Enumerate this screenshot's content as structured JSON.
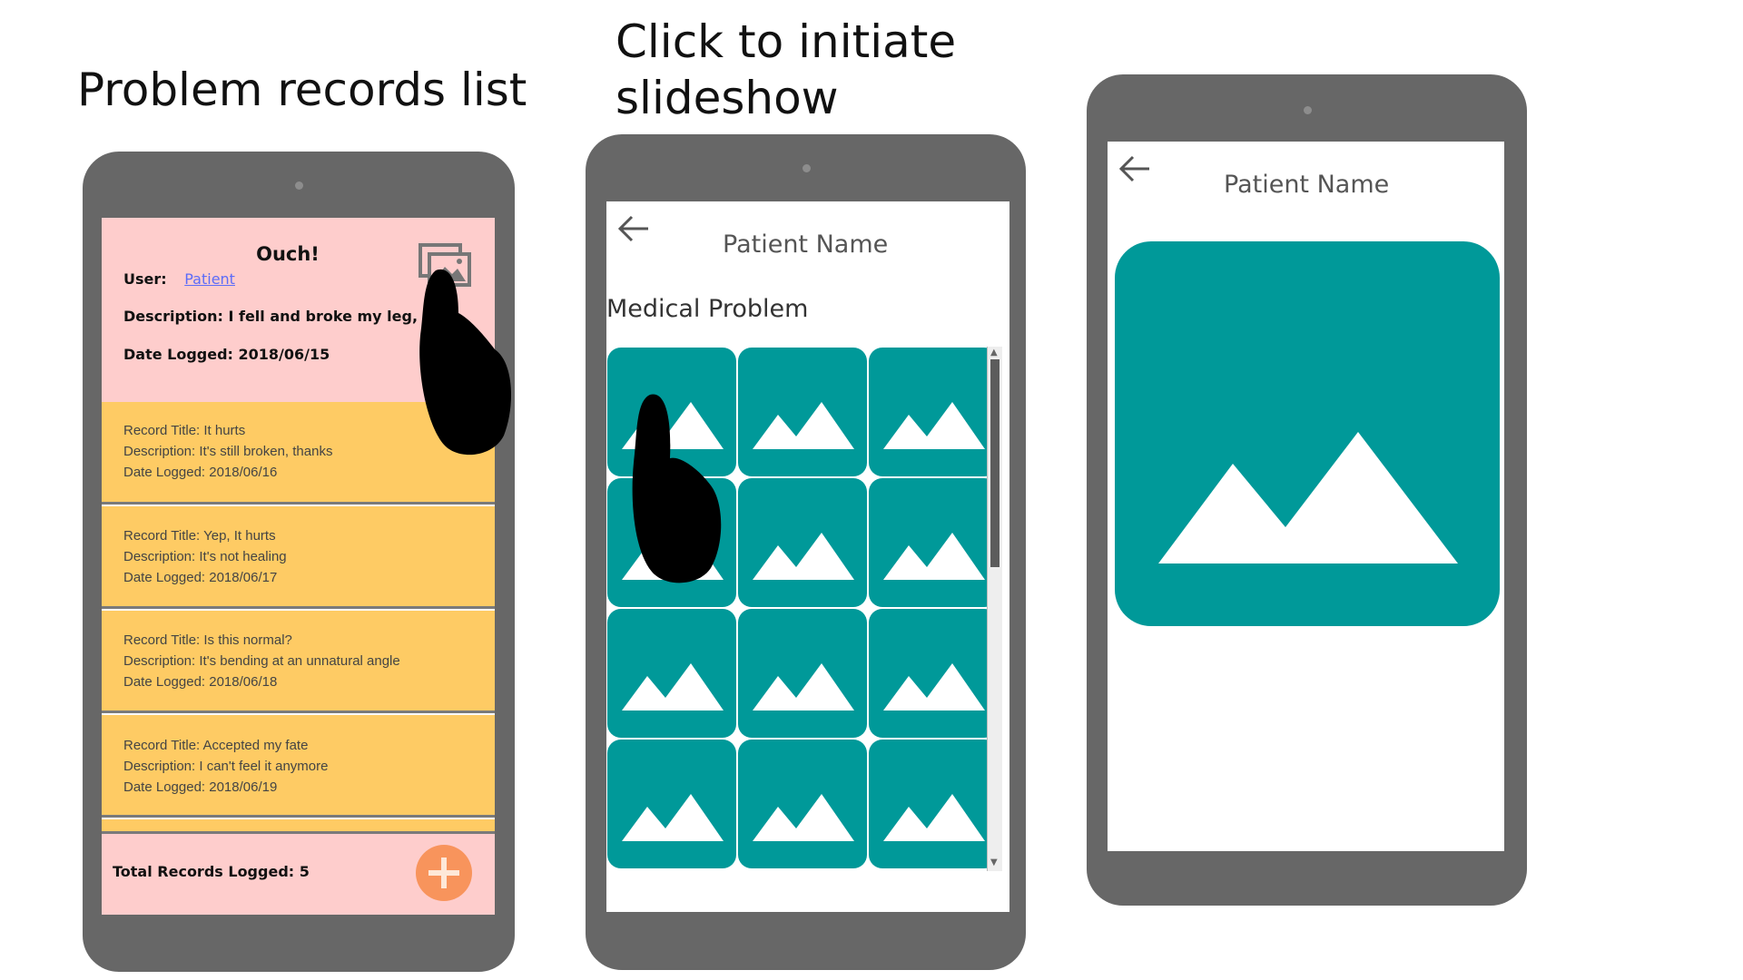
{
  "captions": {
    "c1": "Problem records list",
    "c2_line1": "Click to initiate",
    "c2_line2": "slideshow"
  },
  "problem": {
    "title": "Ouch!",
    "user_label": "User:",
    "user_link": "Patient",
    "description": "Description: I fell and broke my leg, help",
    "date": "Date Logged: 2018/06/15"
  },
  "records": [
    {
      "title": "Record Title: It hurts",
      "description": "Description: It's still broken, thanks",
      "date": "Date Logged: 2018/06/16"
    },
    {
      "title": "Record Title: Yep, It hurts",
      "description": "Description: It's not healing",
      "date": "Date Logged: 2018/06/17"
    },
    {
      "title": "Record Title: Is this normal?",
      "description": "Description: It's bending at an unnatural angle",
      "date": "Date Logged: 2018/06/18"
    },
    {
      "title": "Record Title: Accepted my fate",
      "description": "Description: I can't feel it anymore",
      "date": "Date Logged: 2018/06/19"
    }
  ],
  "footer": {
    "total": "Total Records Logged: 5"
  },
  "gallery": {
    "patient_name": "Patient Name",
    "problem_name": "Medical Problem",
    "photo_count": 12
  },
  "slideshow": {
    "patient_name": "Patient Name"
  },
  "colors": {
    "teal": "#009999",
    "pink": "#fecdcc",
    "yellow": "#fecb64",
    "orange": "#f8945c",
    "device": "#676767"
  },
  "icons": [
    "gallery-icon",
    "add-icon",
    "back-arrow-icon",
    "image-placeholder-icon",
    "pointing-hand-icon"
  ]
}
